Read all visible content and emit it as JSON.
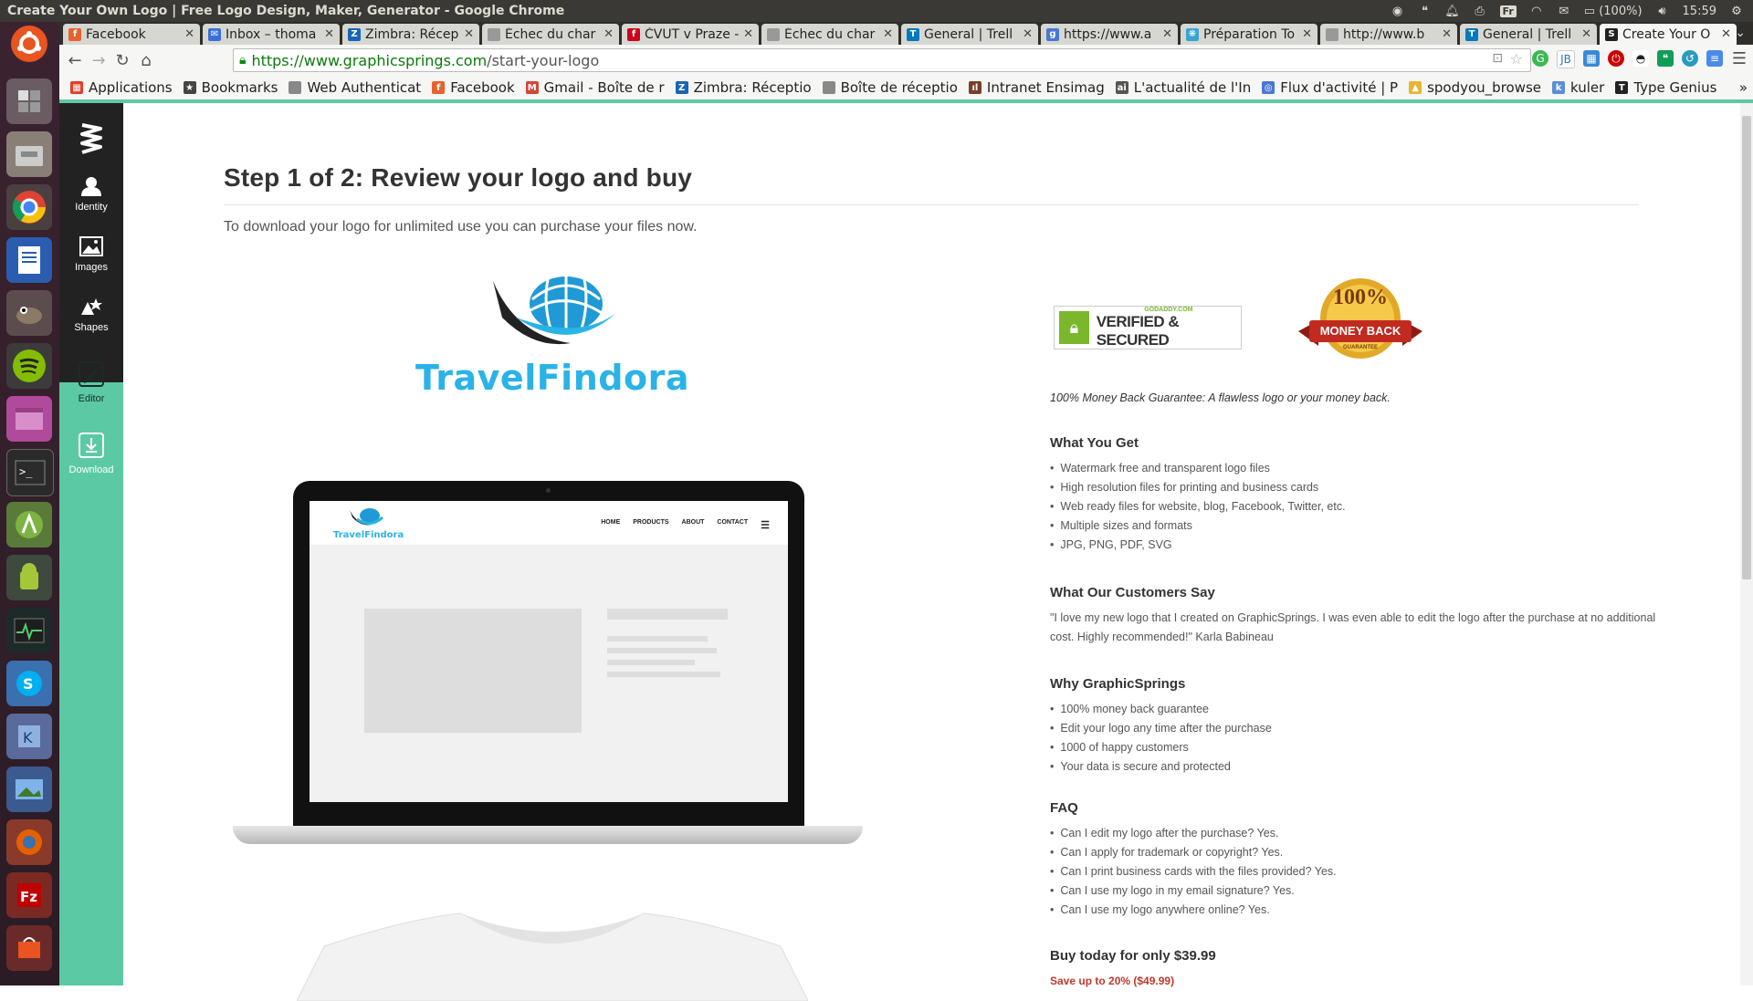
{
  "window": {
    "title": "Create Your Own Logo | Free Logo Design, Maker, Generator - Google Chrome",
    "tray": {
      "keyboard": "Fr",
      "battery": "(100%)",
      "time": "15:59"
    }
  },
  "tabs": [
    {
      "label": "Facebook",
      "color": "#e9622e",
      "glyph": "f"
    },
    {
      "label": "Inbox – thoma",
      "color": "#3b6fd8",
      "glyph": "✉"
    },
    {
      "label": "Zimbra: Récep",
      "color": "#1a64b5",
      "glyph": "Z"
    },
    {
      "label": "Échec du char",
      "color": "#999999",
      "glyph": ""
    },
    {
      "label": "ČVUT v Praze -",
      "color": "#d0021b",
      "glyph": "f"
    },
    {
      "label": "Échec du char",
      "color": "#999999",
      "glyph": ""
    },
    {
      "label": "General | Trell",
      "color": "#0079bf",
      "glyph": "T"
    },
    {
      "label": "https://www.a",
      "color": "#4a77d4",
      "glyph": "g"
    },
    {
      "label": "Préparation To",
      "color": "#3aa3d6",
      "glyph": "❋"
    },
    {
      "label": "http://www.b",
      "color": "#999999",
      "glyph": ""
    },
    {
      "label": "General | Trell",
      "color": "#0079bf",
      "glyph": "T"
    },
    {
      "label": "Create Your O",
      "color": "#222222",
      "glyph": "S"
    }
  ],
  "address_bar": {
    "host": "https://www.graphicsprings.com",
    "path": "/start-your-logo"
  },
  "bookmarks": [
    {
      "label": "Applications",
      "color": "#e23f2a",
      "glyph": "▦"
    },
    {
      "label": "Bookmarks",
      "color": "#444444",
      "glyph": "★"
    },
    {
      "label": "Web Authenticat",
      "color": "#888888",
      "glyph": ""
    },
    {
      "label": "Facebook",
      "color": "#e9622e",
      "glyph": "f"
    },
    {
      "label": "Gmail - Boîte de r",
      "color": "#d44638",
      "glyph": "M"
    },
    {
      "label": "Zimbra: Réceptio",
      "color": "#1a64b5",
      "glyph": "Z"
    },
    {
      "label": "Boîte de réceptio",
      "color": "#888888",
      "glyph": ""
    },
    {
      "label": "Intranet Ensimag",
      "color": "#7a3e2a",
      "glyph": "ıl"
    },
    {
      "label": "L'actualité de l'In",
      "color": "#555555",
      "glyph": "ai"
    },
    {
      "label": "Flux d'activité | P",
      "color": "#4a77d4",
      "glyph": "◎"
    },
    {
      "label": "spodyou_browse",
      "color": "#e7b533",
      "glyph": "▲"
    },
    {
      "label": "kuler",
      "color": "#5a8fd6",
      "glyph": "k"
    },
    {
      "label": "Type Genius",
      "color": "#222222",
      "glyph": "T"
    }
  ],
  "sidebar": [
    {
      "label": "Identity"
    },
    {
      "label": "Images"
    },
    {
      "label": "Shapes"
    },
    {
      "label": "Editor"
    },
    {
      "label": "Download"
    }
  ],
  "page": {
    "title": "Step 1 of 2: Review your logo and buy",
    "subtitle": "To download your logo for unlimited use you can purchase your files now.",
    "logo_name": "TravelFindora",
    "mockup_nav": [
      "HOME",
      "PRODUCTS",
      "ABOUT",
      "CONTACT"
    ]
  },
  "badges": {
    "verified_small": "GODADDY.COM",
    "verified_big": "VERIFIED & SECURED",
    "money_pct": "100%",
    "money_text": "MONEY BACK",
    "money_sub": "GUARANTEE"
  },
  "guarantee_text": "100% Money Back Guarantee: A flawless logo or your money back.",
  "what_you_get": {
    "heading": "What You Get",
    "items": [
      "Watermark free and transparent logo files",
      "High resolution files for printing and business cards",
      "Web ready files for website, blog, Facebook, Twitter, etc.",
      "Multiple sizes and formats",
      "JPG, PNG, PDF, SVG"
    ]
  },
  "customers": {
    "heading": "What Our Customers Say",
    "quote": "\"I love my new logo that I created on GraphicSprings. I was even able to edit the logo after the purchase at no additional cost. Highly recommended!\" Karla Babineau"
  },
  "why": {
    "heading": "Why GraphicSprings",
    "items": [
      "100% money back guarantee",
      "Edit your logo any time after the purchase",
      "1000 of happy customers",
      "Your data is secure and protected"
    ]
  },
  "faq": {
    "heading": "FAQ",
    "items": [
      "Can I edit my logo after the purchase? Yes.",
      "Can I apply for trademark or copyright? Yes.",
      "Can I print business cards with the files provided? Yes.",
      "Can I use my logo in my email signature? Yes.",
      "Can I use my logo anywhere online? Yes."
    ]
  },
  "buy": {
    "price_text": "Buy today for only $39.99",
    "save_text": "Save up to 20% ($49.99)"
  },
  "colors": {
    "teal": "#5bc9a4",
    "brand_blue": "#2ab3e6",
    "sidebar_dark": "#222222"
  }
}
